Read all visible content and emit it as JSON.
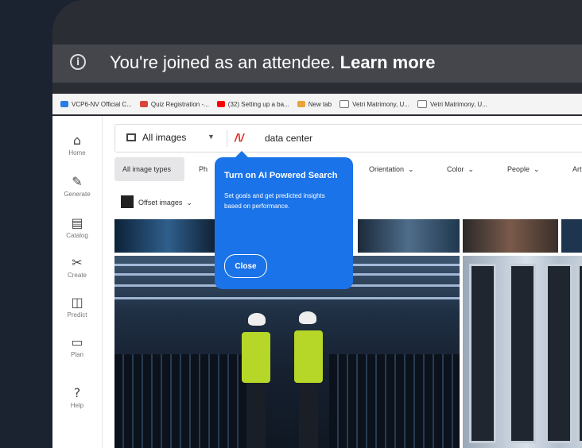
{
  "banner": {
    "message": "You're joined as an attendee.",
    "link": "Learn more"
  },
  "bookmarks": [
    {
      "label": "VCP6-NV Official C..."
    },
    {
      "label": "Quiz Registration -..."
    },
    {
      "label": "(32) Setting up a ba..."
    },
    {
      "label": "New tab"
    },
    {
      "label": "Vetri Matrimony, U..."
    },
    {
      "label": "Vetri Matrimony, U..."
    }
  ],
  "sidebar": [
    {
      "label": "Home"
    },
    {
      "label": "Generate"
    },
    {
      "label": "Catalog"
    },
    {
      "label": "Create"
    },
    {
      "label": "Predict"
    },
    {
      "label": "Plan"
    },
    {
      "label": "Help"
    }
  ],
  "search": {
    "type_label": "All images",
    "query": "data center"
  },
  "filters": [
    {
      "label": "All image types"
    },
    {
      "label": "Ph"
    },
    {
      "label": "Orientation"
    },
    {
      "label": "Color"
    },
    {
      "label": "People"
    },
    {
      "label": "Art"
    }
  ],
  "row2": {
    "offset_label": "Offset images"
  },
  "popup": {
    "title": "Turn on AI Powered Search",
    "body": "Set goals and get predicted insights based on performance.",
    "close_label": "Close"
  },
  "colors": {
    "accent": "#1a73e8",
    "banner": "#46484e",
    "ai_logo": "#e02b20"
  }
}
